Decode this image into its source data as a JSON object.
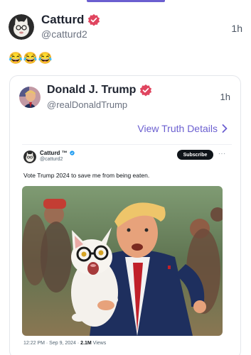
{
  "post": {
    "display_name": "Catturd",
    "handle": "@catturd2",
    "time": "1h",
    "text": "😂😂😂",
    "avatar_icon": "cat-avatar-icon",
    "verified_icon": "verified-badge-icon"
  },
  "quote": {
    "display_name": "Donald J. Trump",
    "handle": "@realDonaldTrump",
    "time": "1h",
    "view_link": "View Truth Details",
    "avatar_icon": "trump-avatar-icon"
  },
  "embedded_tweet": {
    "display_name": "Catturd ™",
    "handle": "@catturd2",
    "subscribe_label": "Subscribe",
    "more_label": "···",
    "text": "Vote Trump 2024 to save me from being eaten.",
    "timestamp": "12:22 PM · Sep 9, 2024 · ",
    "views_count": "2.1M",
    "views_label": " Views",
    "image_description_icon": "trump-carrying-cat-image"
  },
  "colors": {
    "accent": "#6b5fd0",
    "verified": "#e0455f"
  }
}
